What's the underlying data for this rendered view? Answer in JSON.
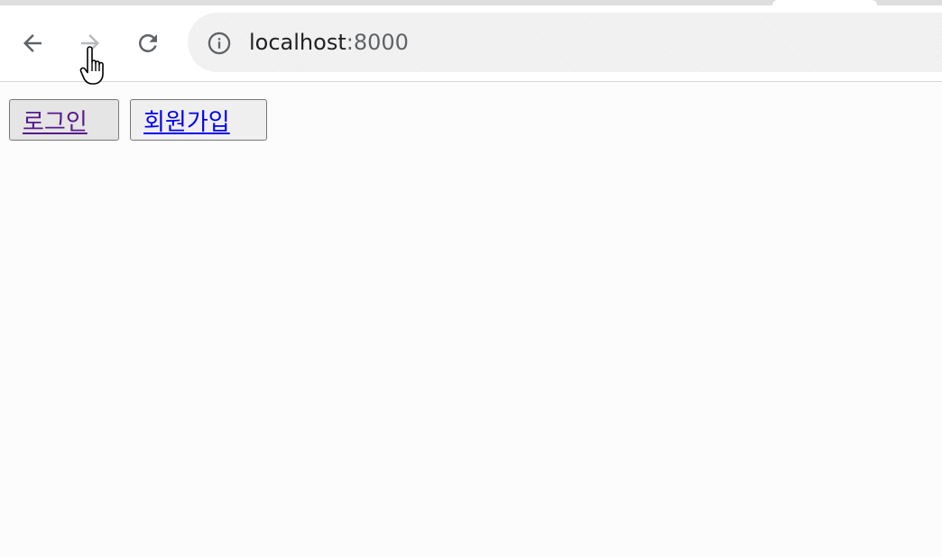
{
  "browser": {
    "address_bar": {
      "host": "localhost",
      "port": ":8000",
      "icon": "info-icon"
    },
    "nav": {
      "back_icon": "arrow-left-icon",
      "forward_icon": "arrow-right-icon",
      "reload_icon": "reload-icon"
    }
  },
  "page": {
    "buttons": [
      {
        "label": "로그인",
        "link_color": "#551a8b",
        "state": "hovered"
      },
      {
        "label": "회원가입",
        "link_color": "#0000ee"
      }
    ]
  },
  "cursor": {
    "type": "hand-pointer-icon"
  }
}
